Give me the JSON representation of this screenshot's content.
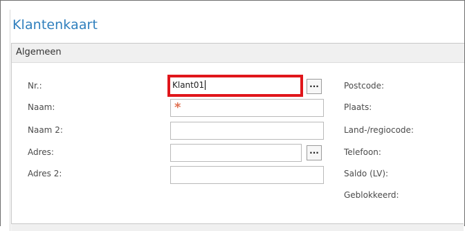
{
  "page": {
    "title": "Klantenkaart"
  },
  "section": {
    "title": "Algemeen"
  },
  "fields_left": [
    {
      "label": "Nr.:",
      "value": "Klant01",
      "placeholder": "",
      "has_lookup": true,
      "focused": true,
      "required": false
    },
    {
      "label": "Naam:",
      "value": "",
      "placeholder": "",
      "has_lookup": false,
      "focused": false,
      "required": true
    },
    {
      "label": "Naam 2:",
      "value": "",
      "placeholder": "",
      "has_lookup": false,
      "focused": false,
      "required": false
    },
    {
      "label": "Adres:",
      "value": "",
      "placeholder": "",
      "has_lookup": true,
      "focused": false,
      "required": false
    },
    {
      "label": "Adres 2:",
      "value": "",
      "placeholder": "",
      "has_lookup": false,
      "focused": false,
      "required": false
    }
  ],
  "fields_right": [
    {
      "label": "Postcode:"
    },
    {
      "label": "Plaats:"
    },
    {
      "label": "Land-/regiocode:"
    },
    {
      "label": "Telefoon:"
    },
    {
      "label": "Saldo (LV):"
    },
    {
      "label": "Geblokkeerd:"
    }
  ],
  "icons": {
    "lookup": "ellipsis-icon",
    "required": "asterisk-icon"
  },
  "glyphs": {
    "lookup": "...",
    "required": "*"
  },
  "colors": {
    "title": "#2f7fbd",
    "focus_frame": "#e0161b",
    "required": "#e07050"
  }
}
